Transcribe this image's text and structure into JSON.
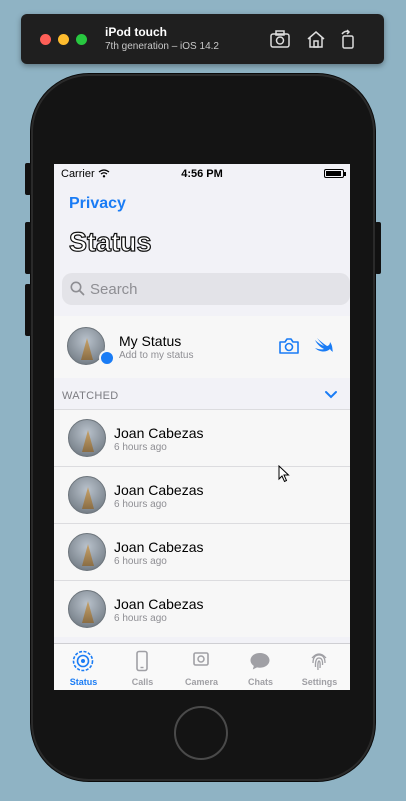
{
  "simulator": {
    "device_name": "iPod touch",
    "device_detail": "7th generation – iOS 14.2",
    "toolbar_icons": [
      "screenshot-icon",
      "home-icon",
      "rotate-icon"
    ]
  },
  "status_bar": {
    "carrier": "Carrier",
    "time": "4:56 PM"
  },
  "nav": {
    "back_label": "Privacy",
    "title": "Status"
  },
  "search": {
    "placeholder": "Search"
  },
  "my_status": {
    "name": "My Status",
    "subtitle": "Add to my status"
  },
  "section": {
    "title": "WATCHED"
  },
  "statuses": [
    {
      "name": "Joan Cabezas",
      "time": "6 hours ago"
    },
    {
      "name": "Joan Cabezas",
      "time": "6 hours ago"
    },
    {
      "name": "Joan Cabezas",
      "time": "6 hours ago"
    },
    {
      "name": "Joan Cabezas",
      "time": "6 hours ago"
    }
  ],
  "tabs": [
    {
      "label": "Status",
      "icon": "status-icon",
      "active": true
    },
    {
      "label": "Calls",
      "icon": "phone-icon",
      "active": false
    },
    {
      "label": "Camera",
      "icon": "camera-icon",
      "active": false
    },
    {
      "label": "Chats",
      "icon": "chat-bubble-icon",
      "active": false
    },
    {
      "label": "Settings",
      "icon": "fingerprint-icon",
      "active": false
    }
  ],
  "colors": {
    "accent": "#1a7cf5",
    "background": "#f2f2f7",
    "secondary_text": "#8e8e93"
  }
}
